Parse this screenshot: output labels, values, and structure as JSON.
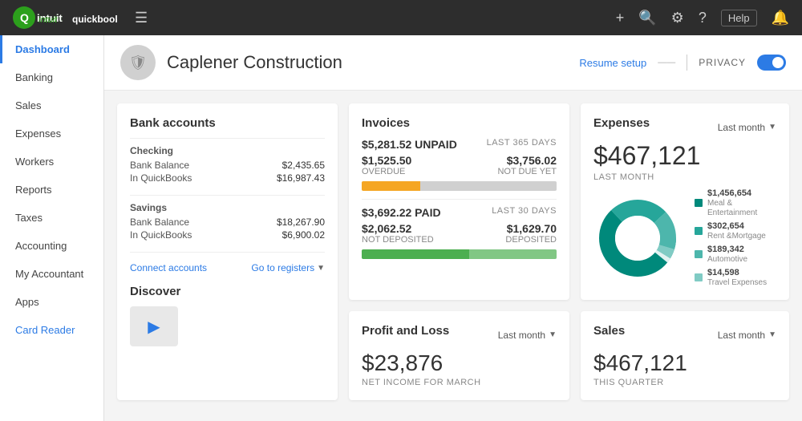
{
  "topnav": {
    "help_label": "Help",
    "hamburger": "≡"
  },
  "sidebar": {
    "items": [
      {
        "id": "dashboard",
        "label": "Dashboard",
        "active": true
      },
      {
        "id": "banking",
        "label": "Banking"
      },
      {
        "id": "sales",
        "label": "Sales"
      },
      {
        "id": "expenses",
        "label": "Expenses"
      },
      {
        "id": "workers",
        "label": "Workers"
      },
      {
        "id": "reports",
        "label": "Reports"
      },
      {
        "id": "taxes",
        "label": "Taxes"
      },
      {
        "id": "accounting",
        "label": "Accounting"
      },
      {
        "id": "my-accountant",
        "label": "My Accountant"
      },
      {
        "id": "apps",
        "label": "Apps"
      },
      {
        "id": "card-reader",
        "label": "Card Reader"
      }
    ]
  },
  "header": {
    "company_name": "Caplener Construction",
    "resume_setup": "Resume setup",
    "privacy_label": "PRIVACY"
  },
  "invoices": {
    "title": "Invoices",
    "unpaid_amount": "$5,281.52 UNPAID",
    "unpaid_period": "LAST 365 DAYS",
    "overdue": "$1,525.50",
    "overdue_label": "OVERDUE",
    "not_due": "$3,756.02",
    "not_due_label": "NOT DUE YET",
    "paid_amount": "$3,692.22 PAID",
    "paid_period": "LAST 30 DAYS",
    "not_deposited": "$2,062.52",
    "not_deposited_label": "NOT DEPOSITED",
    "deposited": "$1,629.70",
    "deposited_label": "DEPOSITED"
  },
  "expenses": {
    "title": "Expenses",
    "period_label": "Last month",
    "total": "$467,121",
    "period_sub": "LAST MONTH",
    "legend": [
      {
        "color": "#00897b",
        "amount": "$1,456,654",
        "label": "Meal & Entertainment"
      },
      {
        "color": "#26a69a",
        "amount": "$302,654",
        "label": "Rent &Mortgage"
      },
      {
        "color": "#4db6ac",
        "amount": "$189,342",
        "label": "Automotive"
      },
      {
        "color": "#80cbc4",
        "amount": "$14,598",
        "label": "Travel Expenses"
      }
    ]
  },
  "bank_accounts": {
    "title": "Bank accounts",
    "checking": {
      "label": "Checking",
      "bank_balance_label": "Bank Balance",
      "bank_balance": "$2,435.65",
      "qb_label": "In QuickBooks",
      "qb_amount": "$16,987.43"
    },
    "savings": {
      "label": "Savings",
      "bank_balance_label": "Bank Balance",
      "bank_balance": "$18,267.90",
      "qb_label": "In QuickBooks",
      "qb_amount": "$6,900.02"
    },
    "connect_accounts": "Connect accounts",
    "go_to_registers": "Go to registers"
  },
  "profit_loss": {
    "title": "Profit and Loss",
    "period_label": "Last month",
    "amount": "$23,876",
    "sub_label": "NET INCOME FOR MARCH"
  },
  "sales": {
    "title": "Sales",
    "period_label": "Last month",
    "amount": "$467,121",
    "sub_label": "THIS QUARTER"
  },
  "discover": {
    "title": "Discover"
  },
  "colors": {
    "accent": "#2c7be5",
    "positive": "#4caf50"
  }
}
